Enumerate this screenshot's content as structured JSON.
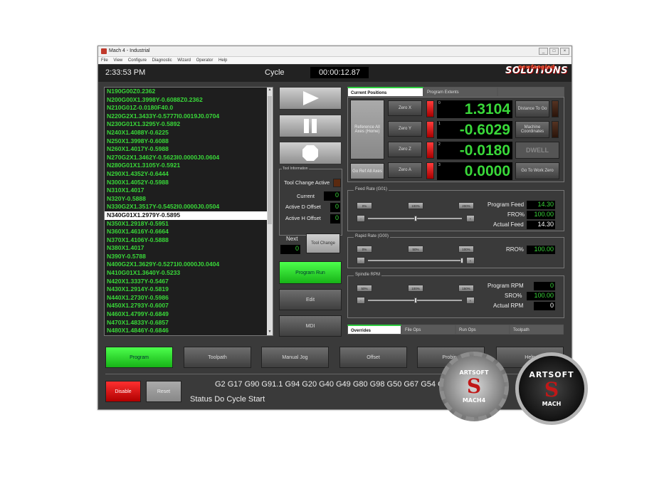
{
  "window": {
    "title": "Mach 4 - Industrial",
    "controls": [
      "_",
      "□",
      "×"
    ]
  },
  "menu": [
    "File",
    "View",
    "Configure",
    "Diagnostic",
    "Wizard",
    "Operator",
    "Help"
  ],
  "header": {
    "clock": "2:33:53 PM",
    "cycle_label": "Cycle",
    "cycle_time": "00:00:12.87",
    "logo_top": "newfangled",
    "logo": "SOLUTIONS"
  },
  "gcode": {
    "lines": [
      "N190G00Z0.2362",
      "N200G00X1.3998Y-0.6088Z0.2362",
      "N210G01Z-0.0180F40.0",
      "N220G2X1.3433Y-0.5777I0.0019J0.0704",
      "N230G01X1.3295Y-0.5892",
      "N240X1.4088Y-0.6225",
      "N250X1.3998Y-0.6088",
      "N260X1.4017Y-0.5988",
      "N270G2X1.3462Y-0.5623I0.0000J0.0604",
      "N280G01X1.3105Y-0.5921",
      "N290X1.4352Y-0.6444",
      "N300X1.4052Y-0.5988",
      "N310X1.4017",
      "N320Y-0.5888",
      "N330G2X1.3517Y-0.5452I0.0000J0.0504",
      "N340G01X1.2979Y-0.5895",
      "N350X1.2918Y-0.5951",
      "N360X1.4616Y-0.6664",
      "N370X1.4106Y-0.5888",
      "N380X1.4017",
      "N390Y-0.5788",
      "N400G2X1.3629Y-0.5271I0.0000J0.0404",
      "N410G01X1.3640Y-0.5233",
      "N420X1.3337Y-0.5467",
      "N430X1.2914Y-0.5819",
      "N440X1.2730Y-0.5986",
      "N450X1.2793Y-0.6007",
      "N460X1.4799Y-0.6849",
      "N470X1.4833Y-0.6857",
      "N480X1.4846Y-0.6846"
    ],
    "selected_index": 15
  },
  "tool": {
    "legend": "Tool Information",
    "change_active_label": "Tool Change Active",
    "current_label": "Current",
    "current": "0",
    "d_offset_label": "Active D Offset",
    "d_offset": "0",
    "h_offset_label": "Active H Offset",
    "h_offset": "0",
    "next_label": "Next",
    "next": "0",
    "tool_change_btn": "Tool Change"
  },
  "actions": {
    "program_run": "Program Run",
    "edit": "Edit",
    "mdi": "MDI"
  },
  "positions": {
    "tabs": [
      "Current Positions",
      "Program Extents"
    ],
    "reference_btn": "Reference All Axes (Home)",
    "goto_zero_btn": "Go Ref All Axes",
    "axes": [
      {
        "zero_label": "Zero X",
        "value": "1.3104",
        "idx": "0"
      },
      {
        "zero_label": "Zero Y",
        "value": "-0.6029",
        "idx": "1"
      },
      {
        "zero_label": "Zero Z",
        "value": "-0.0180",
        "idx": "2"
      },
      {
        "zero_label": "Zero A",
        "value": "0.0000",
        "idx": "3"
      }
    ],
    "distance_btn": "Distance To Go",
    "machine_btn": "Machine Coordinates",
    "dwell": "DWELL",
    "goto_work_btn": "Go To Work Zero"
  },
  "feed": {
    "legend": "Feed Rate (G01)",
    "btns": [
      "0%",
      "100%",
      "200%"
    ],
    "program_feed_label": "Program Feed",
    "program_feed": "14.30",
    "fro_label": "FRO%",
    "fro": "100.00",
    "actual_feed_label": "Actual Feed",
    "actual_feed": "14.30",
    "level": 0.5
  },
  "rapid": {
    "legend": "Rapid Rate (G00)",
    "btns": [
      "0%",
      "50%",
      "100%"
    ],
    "rro_label": "RRO%",
    "rro": "100.00",
    "level": 1.0
  },
  "spindle": {
    "legend": "Spindle RPM",
    "btns": [
      "50%",
      "100%",
      "150%"
    ],
    "program_rpm_label": "Program RPM",
    "program_rpm": "0",
    "sro_label": "SRO%",
    "sro": "100.00",
    "actual_rpm_label": "Actual RPM",
    "actual_rpm": "0",
    "level": 0.5
  },
  "lower_tabs": [
    "Overrides",
    "File Ops",
    "Run Ops",
    "Toolpath"
  ],
  "nav": [
    "Program",
    "Toolpath",
    "Manual Jog",
    "Offset",
    "Probing",
    "Help"
  ],
  "footer": {
    "disable": "Disable",
    "reset": "Reset",
    "gmodal": "G2 G17 G90 G91.1 G94 G20 G40 G49 G80 G98 G50 G67 G54 G64 G69 G15",
    "status": "Status Do Cycle Start"
  },
  "badges": {
    "b1_top": "ARTSOFT",
    "b1_bottom": "MACH4",
    "b2_top": "ARTSOFT",
    "b2_bottom": "MACH"
  }
}
